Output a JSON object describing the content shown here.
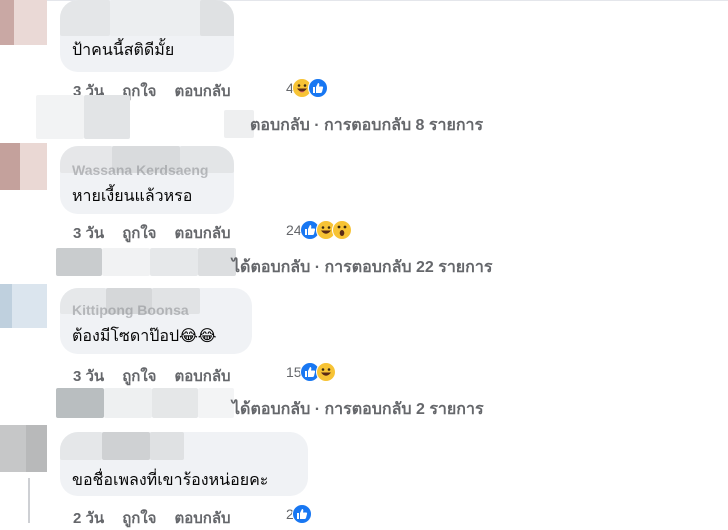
{
  "comments": [
    {
      "name": "",
      "text": "ป้าคนนี้สติดีมั้ย",
      "time": "3 วัน",
      "like_label": "ถูกใจ",
      "reply_label": "ตอบกลับ",
      "reaction_count": "4",
      "reactions": [
        "haha-icon",
        "like-icon"
      ],
      "replies_text": "ตอบกลับ · การตอบกลับ 8 รายการ"
    },
    {
      "name": "Wassana Kerdsaeng",
      "text": "หายเงี้ยนแล้วหรอ",
      "time": "3 วัน",
      "like_label": "ถูกใจ",
      "reply_label": "ตอบกลับ",
      "reaction_count": "24",
      "reactions": [
        "like-icon",
        "haha-icon",
        "wow-icon"
      ],
      "replies_text": "ได้ตอบกลับ · การตอบกลับ 22 รายการ"
    },
    {
      "name": "Kittipong Boonsa",
      "text": "ต้องมีโซดาป๊อป😂😂",
      "time": "3 วัน",
      "like_label": "ถูกใจ",
      "reply_label": "ตอบกลับ",
      "reaction_count": "15",
      "reactions": [
        "like-icon",
        "haha-icon"
      ],
      "replies_text": "ได้ตอบกลับ · การตอบกลับ 2 รายการ"
    },
    {
      "name": "",
      "text": "ขอชื่อเพลงที่เขาร้องหน่อยคะ",
      "time": "2 วัน",
      "like_label": "ถูกใจ",
      "reply_label": "ตอบกลับ",
      "reaction_count": "2",
      "reactions": [
        "like-icon"
      ],
      "replies_text": ""
    }
  ],
  "colors": {
    "bubble": "#f0f2f5",
    "meta_text": "#65676b",
    "like_blue": "#1877f2",
    "haha_yellow": "#f7c335"
  }
}
